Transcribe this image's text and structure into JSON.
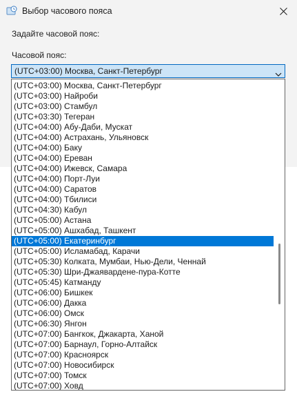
{
  "window": {
    "title": "Выбор часового пояса",
    "icon": "clock-globe-icon",
    "close_icon": "close-icon"
  },
  "dialog": {
    "prompt": "Задайте часовой пояс:",
    "timezone_label": "Часовой пояс:",
    "selected_value": "(UTC+03:00) Москва, Санкт-Петербург",
    "dropdown_icon": "chevron-down-icon"
  },
  "colors": {
    "selection": "#0078d7",
    "combo_border": "#0067c0",
    "combo_background": "#cce4f7"
  },
  "timezones": [
    "(UTC+03:00) Москва, Санкт-Петербург",
    "(UTC+03:00) Найроби",
    "(UTC+03:00) Стамбул",
    "(UTC+03:30) Тегеран",
    "(UTC+04:00) Абу-Даби, Мускат",
    "(UTC+04:00) Астрахань, Ульяновск",
    "(UTC+04:00) Баку",
    "(UTC+04:00) Ереван",
    "(UTC+04:00) Ижевск, Самара",
    "(UTC+04:00) Порт-Луи",
    "(UTC+04:00) Саратов",
    "(UTC+04:00) Тбилиси",
    "(UTC+04:30) Кабул",
    "(UTC+05:00) Астана",
    "(UTC+05:00) Ашхабад, Ташкент",
    "(UTC+05:00) Екатеринбург",
    "(UTC+05:00) Исламабад, Карачи",
    "(UTC+05:30) Колката, Мумбаи, Нью-Дели, Ченнай",
    "(UTC+05:30) Шри-Джаявардене-пура-Котте",
    "(UTC+05:45) Катманду",
    "(UTC+06:00) Бишкек",
    "(UTC+06:00) Дакка",
    "(UTC+06:00) Омск",
    "(UTC+06:30) Янгон",
    "(UTC+07:00) Бангкок, Джакарта, Ханой",
    "(UTC+07:00) Барнаул, Горно-Алтайск",
    "(UTC+07:00) Красноярск",
    "(UTC+07:00) Новосибирск",
    "(UTC+07:00) Томск",
    "(UTC+07:00) Ховд"
  ],
  "highlighted_timezone": "(UTC+05:00) Екатеринбург"
}
